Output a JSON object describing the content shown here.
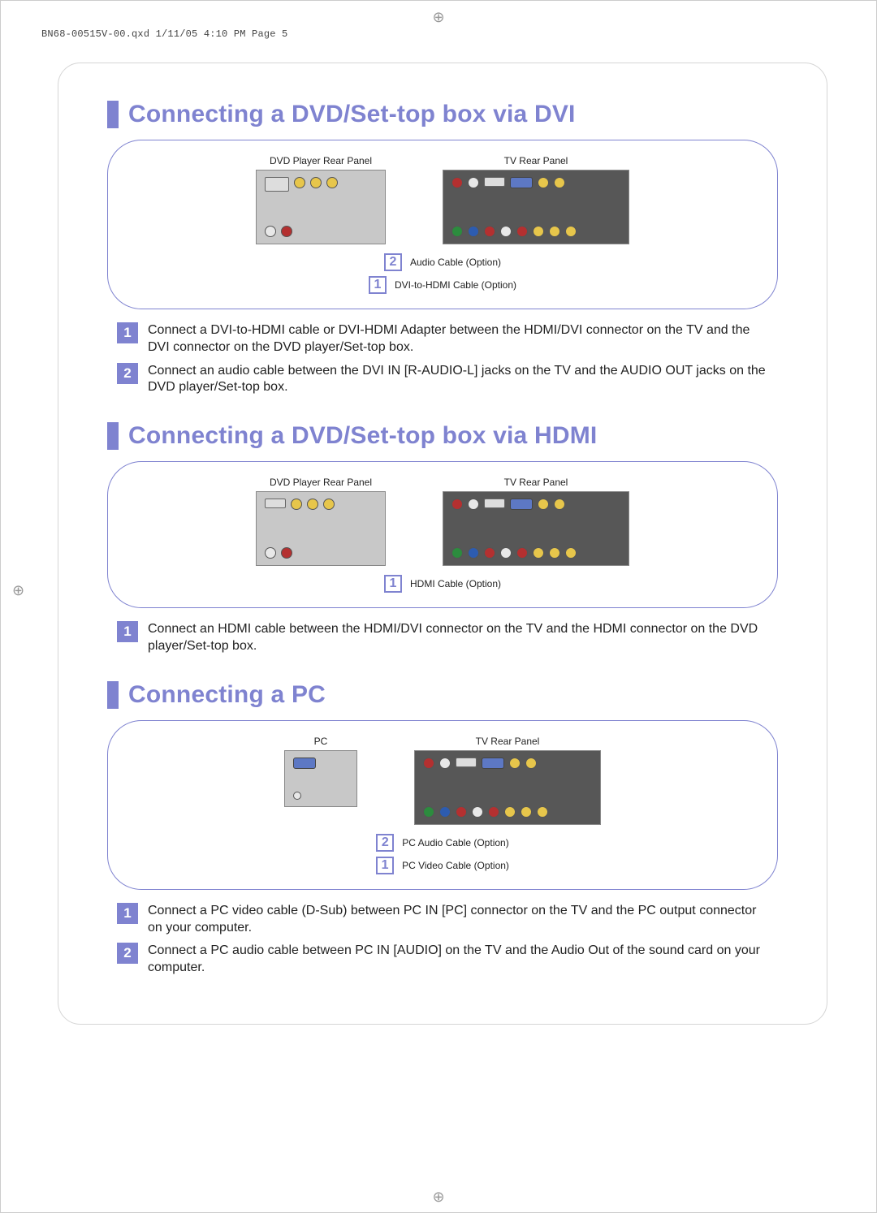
{
  "printHeader": "BN68-00515V-00.qxd  1/11/05 4:10 PM  Page 5",
  "sections": [
    {
      "title": "Connecting a DVD/Set-top box via DVI",
      "leftPanelLabel": "DVD Player Rear Panel",
      "rightPanelLabel": "TV Rear Panel",
      "diagramCallouts": [
        {
          "num": "2",
          "text": "Audio Cable (Option)"
        },
        {
          "num": "1",
          "text": "DVI-to-HDMI Cable (Option)"
        }
      ],
      "steps": [
        {
          "num": "1",
          "text": "Connect a DVI-to-HDMI cable or DVI-HDMI Adapter between the HDMI/DVI connector on the TV and the DVI connector on the DVD player/Set-top box."
        },
        {
          "num": "2",
          "text": "Connect an audio cable between the DVI IN [R-AUDIO-L] jacks on the TV and the AUDIO OUT jacks on the DVD player/Set-top box."
        }
      ]
    },
    {
      "title": "Connecting a DVD/Set-top box via HDMI",
      "leftPanelLabel": "DVD Player Rear Panel",
      "rightPanelLabel": "TV Rear Panel",
      "diagramCallouts": [
        {
          "num": "1",
          "text": "HDMI Cable (Option)"
        }
      ],
      "steps": [
        {
          "num": "1",
          "text": "Connect an HDMI cable between the HDMI/DVI connector on the TV and the HDMI connector on the DVD player/Set-top box."
        }
      ]
    },
    {
      "title": "Connecting a PC",
      "leftPanelLabel": "PC",
      "rightPanelLabel": "TV Rear Panel",
      "diagramCallouts": [
        {
          "num": "2",
          "text": "PC Audio Cable (Option)"
        },
        {
          "num": "1",
          "text": "PC Video Cable (Option)"
        }
      ],
      "steps": [
        {
          "num": "1",
          "text": "Connect a PC video cable (D-Sub) between PC IN [PC] connector on the TV and the PC output connector on your computer."
        },
        {
          "num": "2",
          "text": "Connect a PC audio cable between PC IN [AUDIO] on the TV and the Audio Out of the sound card on your computer."
        }
      ]
    }
  ]
}
